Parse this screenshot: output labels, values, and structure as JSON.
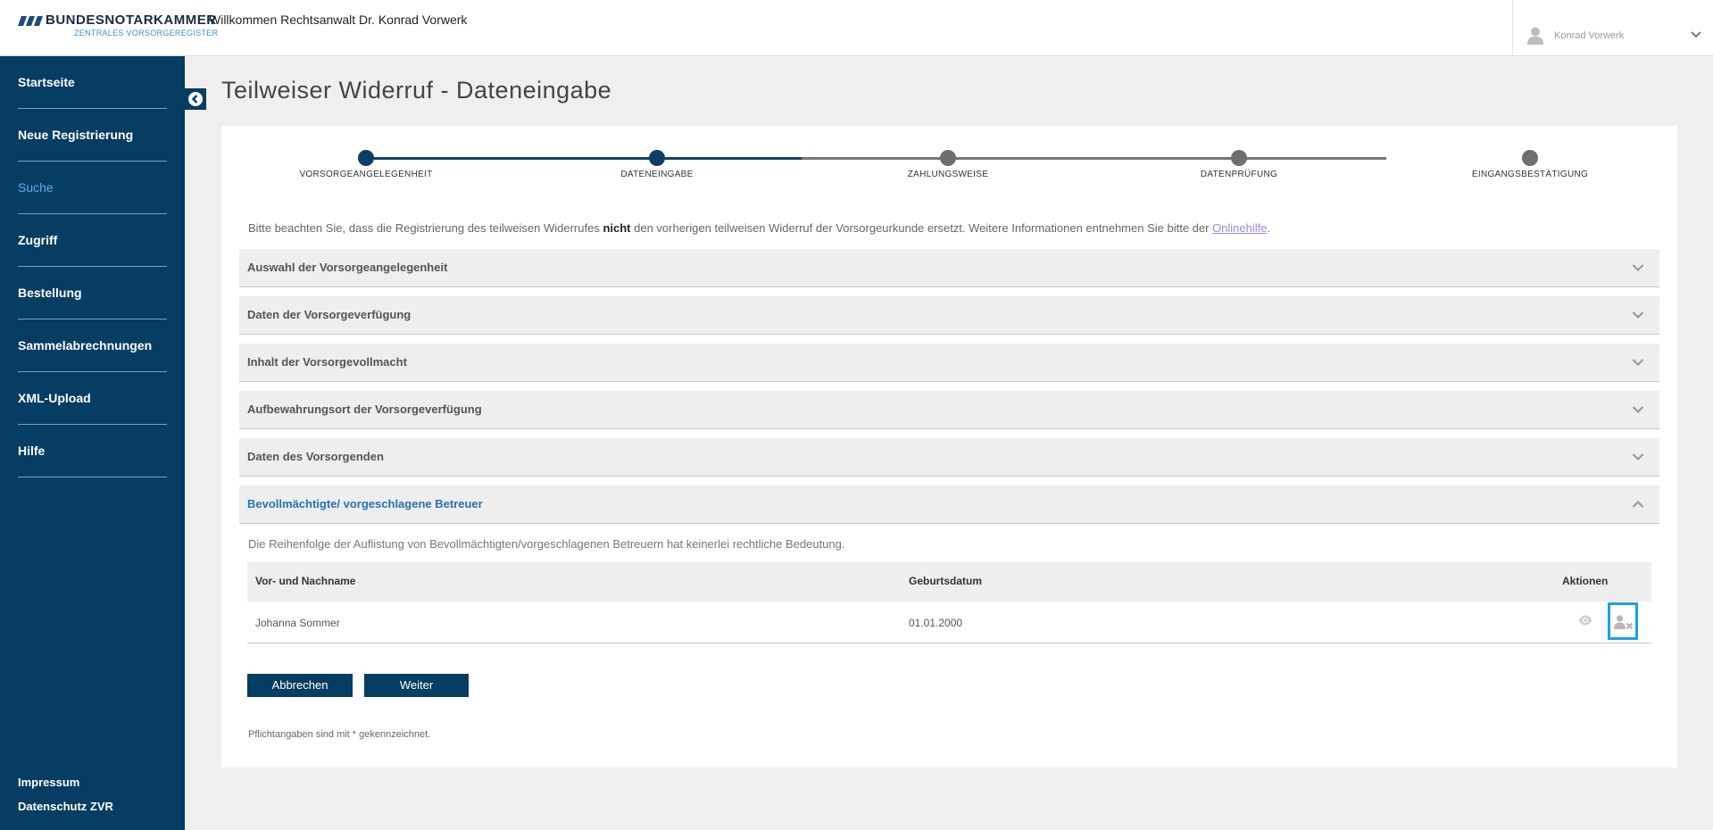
{
  "header": {
    "logo_title": "BUNDESNOTARKAMMER",
    "logo_subtitle": "ZENTRALES VORSORGEREGISTER",
    "welcome": "Willkommen Rechtsanwalt Dr. Konrad Vorwerk",
    "user_name": "Konrad Vorwerk"
  },
  "sidebar": {
    "items": [
      {
        "label": "Startseite"
      },
      {
        "label": "Neue Registrierung"
      },
      {
        "label": "Suche"
      },
      {
        "label": "Zugriff"
      },
      {
        "label": "Bestellung"
      },
      {
        "label": "Sammelabrechnungen"
      },
      {
        "label": "XML-Upload"
      },
      {
        "label": "Hilfe"
      }
    ],
    "active_item": "Suche",
    "footer": {
      "impressum": "Impressum",
      "datenschutz": "Datenschutz ZVR"
    }
  },
  "page": {
    "title": "Teilweiser Widerruf - Dateneingabe"
  },
  "stepper": {
    "steps": [
      "VORSORGEANGELEGENHEIT",
      "DATENEINGABE",
      "ZAHLUNGSWEISE",
      "DATENPRÜFUNG",
      "EINGANGSBESTÄTIGUNG"
    ],
    "current_step": 2
  },
  "notice": {
    "before": "Bitte beachten Sie, dass die Registrierung des teilweisen Widerrufes ",
    "bold": "nicht",
    "after": " den vorherigen teilweisen Widerruf der Vorsorgeurkunde ersetzt. Weitere Informationen entnehmen Sie bitte der ",
    "link": "Onlinehilfe",
    "end": "."
  },
  "accordion": {
    "sections": [
      {
        "title": "Auswahl der Vorsorgeangelegenheit",
        "expanded": false
      },
      {
        "title": "Daten der Vorsorgeverfügung",
        "expanded": false
      },
      {
        "title": "Inhalt der Vorsorgevollmacht",
        "expanded": false
      },
      {
        "title": "Aufbewahrungsort der Vorsorgeverfügung",
        "expanded": false
      },
      {
        "title": "Daten des Vorsorgenden",
        "expanded": false
      },
      {
        "title": "Bevollmächtigte/ vorgeschlagene Betreuer",
        "expanded": true
      }
    ]
  },
  "betreuer": {
    "info": "Die Reihenfolge der Auflistung von Bevollmächtigten/vorgeschlagenen Betreuern hat keinerlei rechtliche Bedeutung.",
    "columns": {
      "name": "Vor- und Nachname",
      "birthdate": "Geburtsdatum",
      "actions": "Aktionen"
    },
    "rows": [
      {
        "name": "Johanna Sommer",
        "birthdate": "01.01.2000"
      }
    ]
  },
  "buttons": {
    "cancel": "Abbrechen",
    "next": "Weiter"
  },
  "footer_note": "Pflichtangaben sind mit * gekennzeichnet.",
  "colors": {
    "sidebar_bg": "#063d63",
    "active_nav": "#5ab0f0",
    "section_open_title": "#2673b8",
    "highlight_border": "#1aa0e6"
  },
  "icons": [
    "user-icon",
    "chevron-down-icon",
    "collapse-arrow-icon",
    "eye-icon",
    "remove-user-icon"
  ]
}
